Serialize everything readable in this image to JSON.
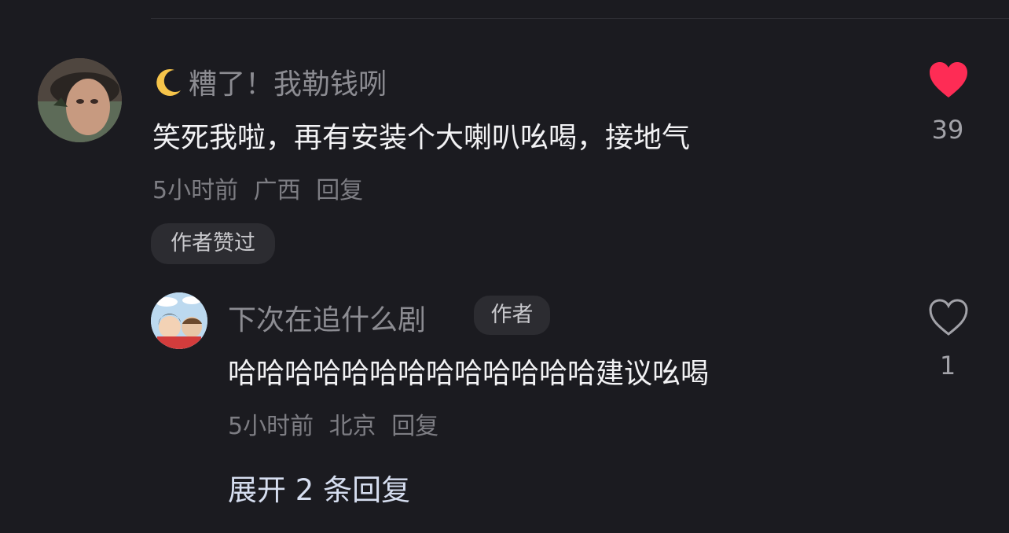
{
  "comment": {
    "username": "糟了！我勒钱咧",
    "text": "笑死我啦，再有安装个大喇叭吆喝，接地气",
    "time": "5小时前",
    "location": "广西",
    "reply_label": "回复",
    "badge": "作者赞过",
    "likes": "39",
    "liked": true,
    "like_color": "#fe2c55"
  },
  "reply": {
    "username": "下次在追什么剧",
    "author_tag": "作者",
    "text": "哈哈哈哈哈哈哈哈哈哈哈哈哈建议吆喝",
    "time": "5小时前",
    "location": "北京",
    "reply_label": "回复",
    "likes": "1",
    "liked": false
  },
  "expand_label": "展开 2 条回复"
}
